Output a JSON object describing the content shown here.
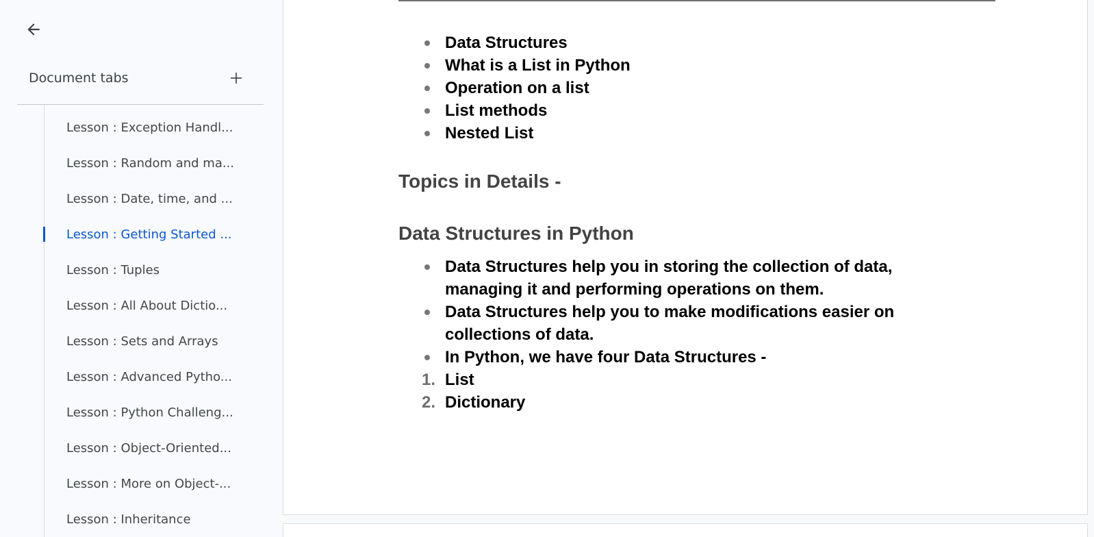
{
  "sidebar": {
    "header_label": "Document tabs",
    "tabs": [
      {
        "label": "Lesson : Exception Handl..."
      },
      {
        "label": "Lesson : Random and ma..."
      },
      {
        "label": "Lesson : Date, time, and ..."
      },
      {
        "label": "Lesson : Getting Started ...",
        "active": true
      },
      {
        "label": "Lesson : Tuples"
      },
      {
        "label": "Lesson : All About Dictio..."
      },
      {
        "label": "Lesson : Sets and Arrays"
      },
      {
        "label": "Lesson : Advanced Pytho..."
      },
      {
        "label": "Lesson : Python Challeng..."
      },
      {
        "label": "Lesson : Object-Oriented..."
      },
      {
        "label": "Lesson : More on Object-..."
      },
      {
        "label": "Lesson : Inheritance"
      }
    ]
  },
  "document": {
    "topics_list": [
      "Data Structures",
      "What is a List in Python",
      "Operation on a list",
      "List methods",
      "Nested List"
    ],
    "heading_topics": "Topics in Details -",
    "heading_ds": "Data Structures in Python",
    "ds_bullets": [
      "Data Structures help you in storing the collection of data, managing it and performing operations on them.",
      "Data Structures help you to make modifications easier on collections of data.",
      "In Python, we have four Data Structures -"
    ],
    "ds_numbered": [
      {
        "num": "1.",
        "text": "List"
      },
      {
        "num": "2.",
        "text": "Dictionary"
      }
    ]
  },
  "icons": {
    "back": "arrow-left-icon",
    "add": "plus-icon"
  },
  "colors": {
    "active_tab": "#0b57d0",
    "heading": "#434343"
  }
}
